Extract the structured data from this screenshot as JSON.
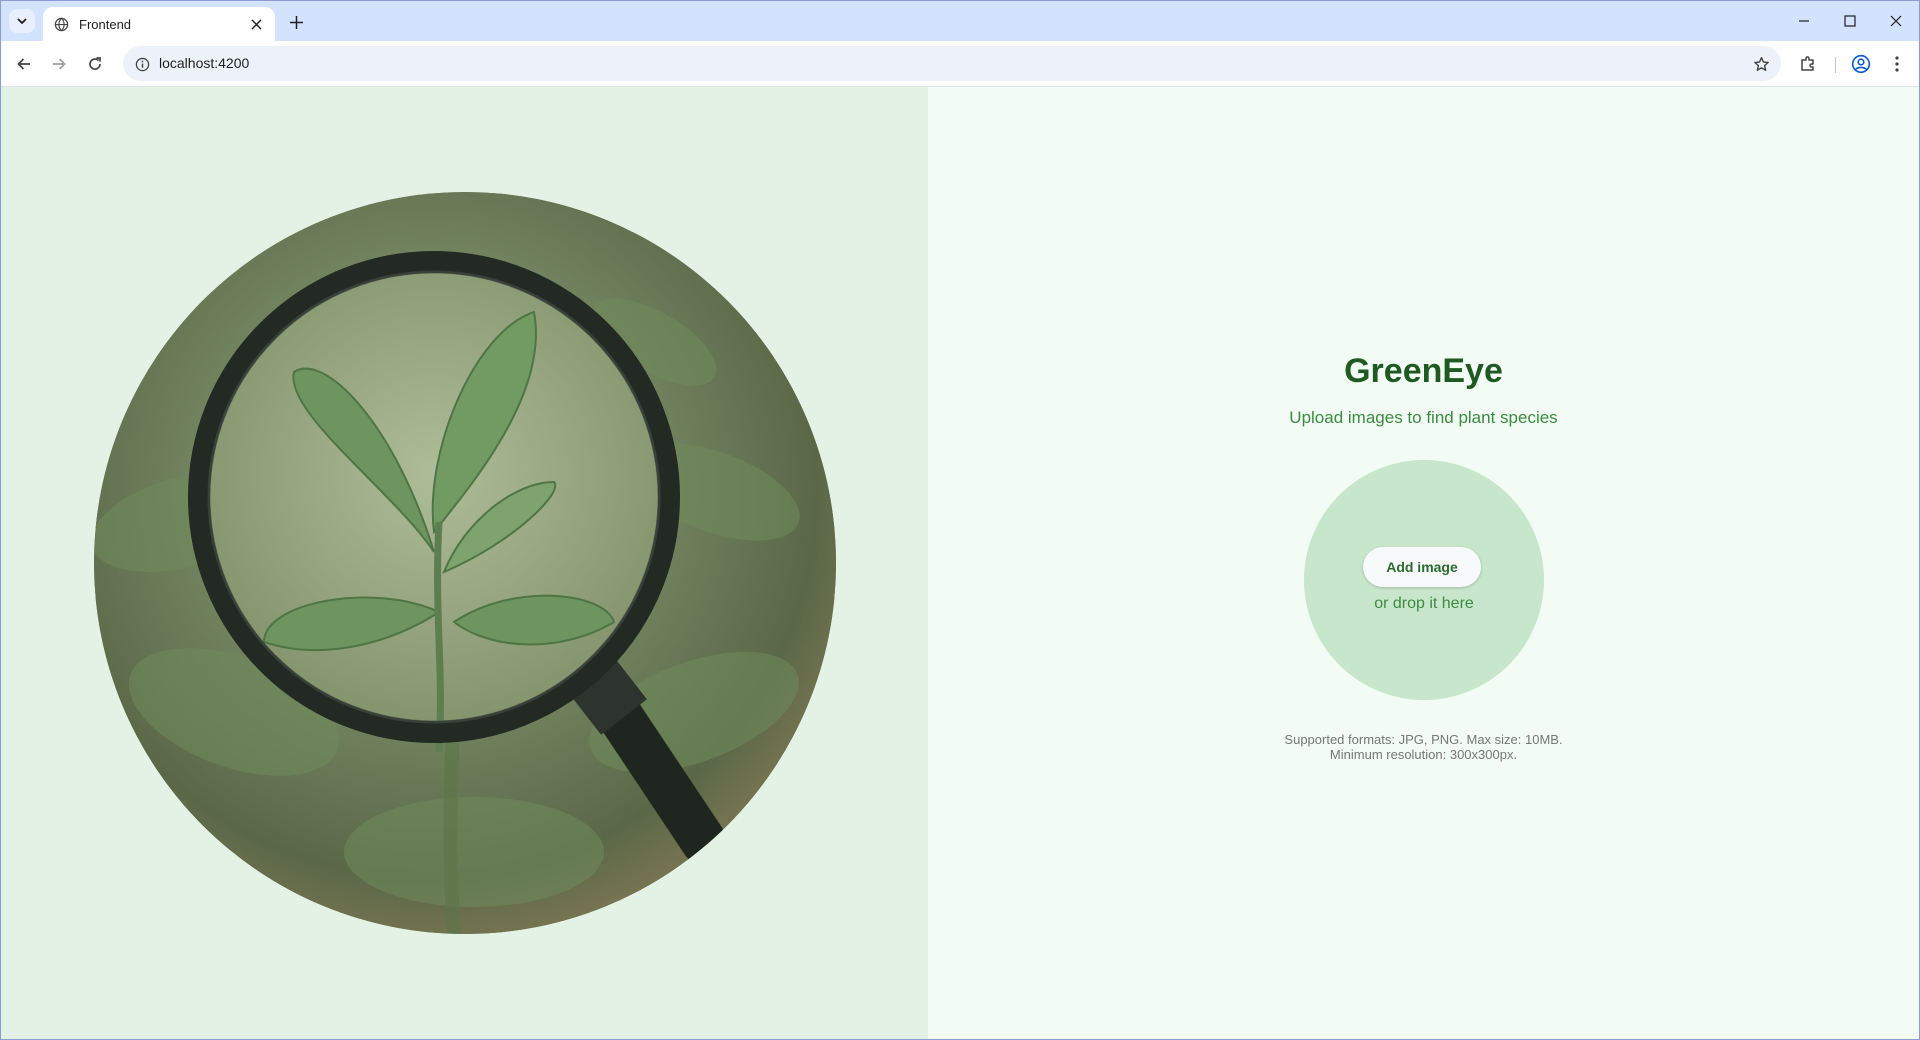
{
  "browser": {
    "tab_title": "Frontend",
    "url": "localhost:4200"
  },
  "app": {
    "title": "GreenEye",
    "subtitle": "Upload images to find plant species",
    "add_button_label": "Add image",
    "drop_text": "or drop it here",
    "hint_line1": "Supported formats: JPG, PNG. Max size: 10MB.",
    "hint_line2": "Minimum resolution: 300x300px."
  },
  "colors": {
    "left_background": "#e3f2e5",
    "right_background": "#f2fcf4",
    "title_green": "#1e5a22",
    "accent_green": "#3d8a41",
    "dropzone": "#c8e6cb"
  },
  "icons": {
    "hero_image": "plant-under-magnifying-glass"
  }
}
